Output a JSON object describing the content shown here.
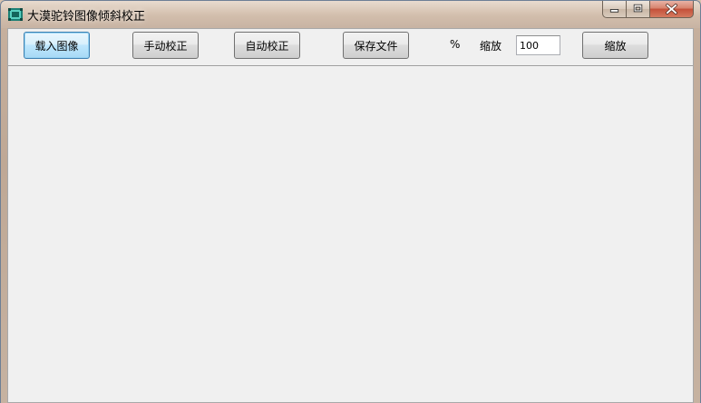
{
  "window": {
    "title": "大漠驼铃图像倾斜校正"
  },
  "toolbar": {
    "load_image_label": "载入图像",
    "manual_correct_label": "手动校正",
    "auto_correct_label": "自动校正",
    "save_file_label": "保存文件",
    "percent_label": "%",
    "zoom_label": "缩放",
    "zoom_value": "100",
    "zoom_button_label": "缩放"
  },
  "icons": {
    "app": "app-icon",
    "minimize": "minimize-icon",
    "maximize": "maximize-icon",
    "close": "close-icon"
  },
  "colors": {
    "focus_border": "#3c7fb1",
    "close_button": "#c4503a",
    "client_background": "#f0f0f0"
  }
}
